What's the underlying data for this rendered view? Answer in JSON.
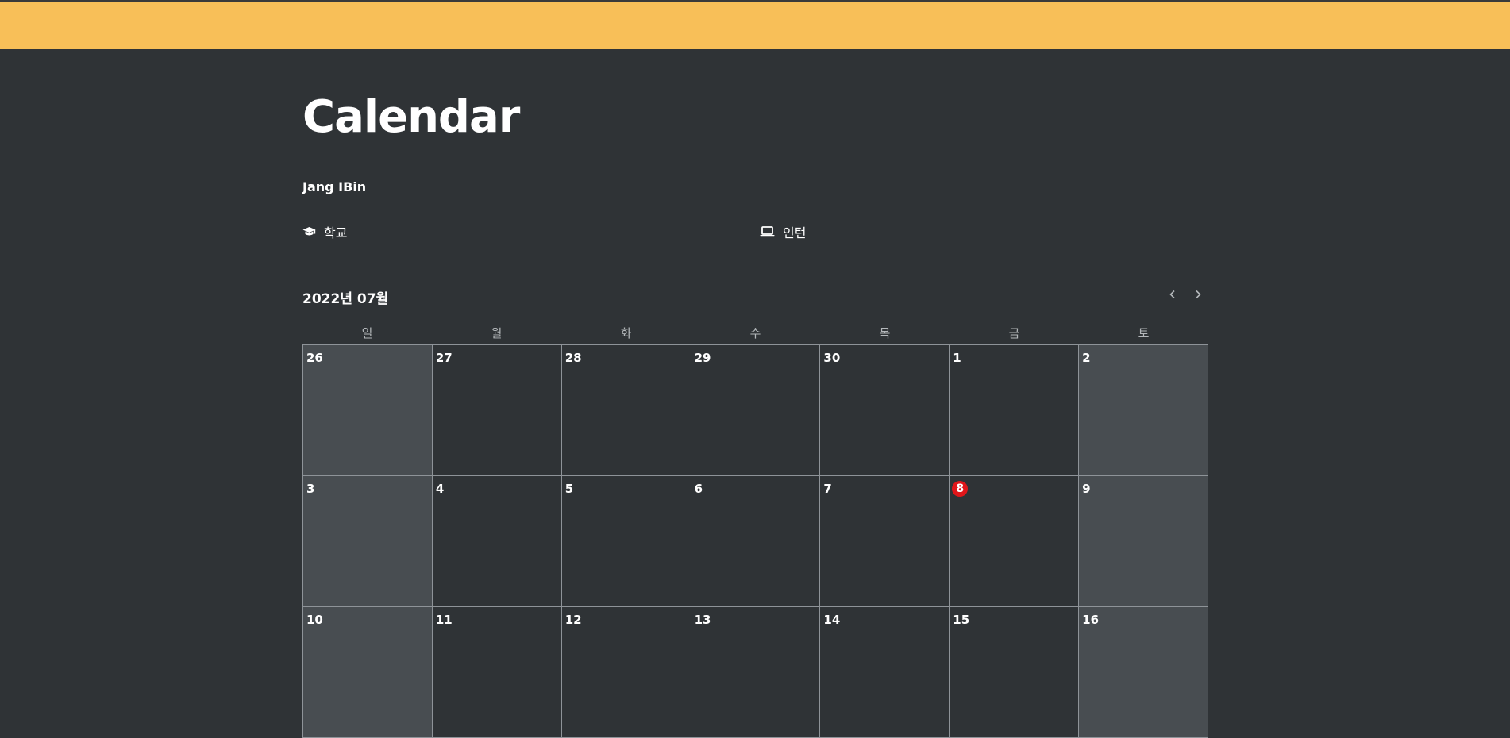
{
  "colors": {
    "topbar": "#f8bf58",
    "background": "#2f3336",
    "weekend_cell": "#484d51",
    "today_marker": "#e0161a",
    "grid_line": "#8e9398"
  },
  "header": {
    "title": "Calendar",
    "author": "Jang IBin"
  },
  "categories": [
    {
      "icon": "graduation-cap-icon",
      "label": "학교"
    },
    {
      "icon": "laptop-icon",
      "label": "인턴"
    }
  ],
  "calendar": {
    "month_title": "2022년 07월",
    "prev_icon": "chevron-left-icon",
    "next_icon": "chevron-right-icon",
    "weekdays": [
      "일",
      "월",
      "화",
      "수",
      "목",
      "금",
      "토"
    ],
    "today": "8",
    "weeks": [
      [
        "26",
        "27",
        "28",
        "29",
        "30",
        "1",
        "2"
      ],
      [
        "3",
        "4",
        "5",
        "6",
        "7",
        "8",
        "9"
      ],
      [
        "10",
        "11",
        "12",
        "13",
        "14",
        "15",
        "16"
      ]
    ]
  }
}
